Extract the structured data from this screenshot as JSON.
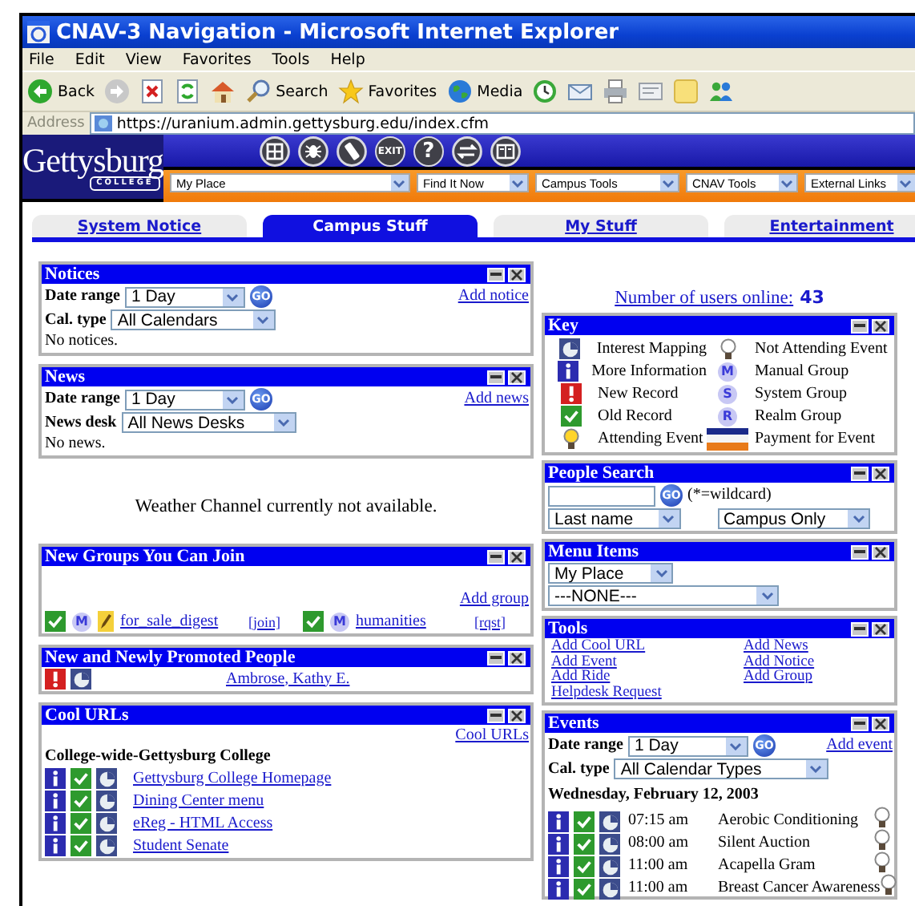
{
  "window": {
    "title": "CNAV-3 Navigation - Microsoft Internet Explorer"
  },
  "menu_bar": [
    "File",
    "Edit",
    "View",
    "Favorites",
    "Tools",
    "Help"
  ],
  "toolbar": [
    {
      "kind": "back",
      "label": "Back"
    },
    {
      "kind": "forward"
    },
    {
      "kind": "stop"
    },
    {
      "kind": "refresh"
    },
    {
      "kind": "home"
    },
    {
      "kind": "search",
      "label": "Search"
    },
    {
      "kind": "favorites",
      "label": "Favorites"
    },
    {
      "kind": "media",
      "label": "Media"
    },
    {
      "kind": "history"
    },
    {
      "kind": "mail"
    },
    {
      "kind": "print"
    },
    {
      "kind": "edit"
    },
    {
      "kind": "notes"
    },
    {
      "kind": "messenger"
    }
  ],
  "address_bar": {
    "label": "Address",
    "value": "https://uranium.admin.gettysburg.edu/index.cfm"
  },
  "site_header": {
    "logo": {
      "name": "Gettysburg",
      "subtitle": "COLLEGE"
    },
    "icons": [
      {
        "kind": "window"
      },
      {
        "kind": "bug"
      },
      {
        "kind": "phone"
      },
      {
        "kind": "label",
        "text": "EXIT"
      },
      {
        "kind": "label",
        "text": "?"
      },
      {
        "kind": "arrows"
      },
      {
        "kind": "book"
      }
    ],
    "dropdowns": [
      "My Place",
      "Find It Now",
      "Campus Tools",
      "CNAV Tools",
      "External Links"
    ]
  },
  "tabs": [
    {
      "label": "System Notice",
      "selected": false
    },
    {
      "label": "Campus Stuff",
      "selected": true
    },
    {
      "label": "My Stuff",
      "selected": false
    },
    {
      "label": "Entertainment",
      "selected": false
    }
  ],
  "left": [
    {
      "kind": "filter",
      "title": "Notices",
      "action": "Add notice",
      "filters": [
        {
          "label": "Date range",
          "value": "1 Day",
          "go": "GO"
        },
        {
          "label": "Cal. type",
          "value": "All Calendars"
        }
      ],
      "message": "No notices."
    },
    {
      "kind": "filter",
      "title": "News",
      "action": "Add news",
      "filters": [
        {
          "label": "Date range",
          "value": "1 Day",
          "go": "GO"
        },
        {
          "label": "News desk",
          "value": "All News Desks"
        }
      ],
      "message": "No news."
    },
    {
      "kind": "notice",
      "text": "Weather Channel currently not available."
    },
    {
      "kind": "groups",
      "title": "New Groups You Can Join",
      "action": "Add group",
      "groups": [
        {
          "kind": "old",
          "badge": "M",
          "editable": true,
          "name": "for_sale_digest",
          "action": "[join]"
        },
        {
          "kind": "old",
          "badge": "M",
          "editable": false,
          "name": "humanities",
          "action": "[rqst]"
        }
      ]
    },
    {
      "kind": "people",
      "title": "New and Newly Promoted People",
      "people": [
        {
          "kind": "new",
          "name": "Ambrose, Kathy E."
        }
      ]
    },
    {
      "kind": "links",
      "title": "Cool URLs",
      "action": "Cool URLs",
      "heading": "College-wide-Gettysburg College",
      "links": [
        {
          "kind": "old",
          "label": "Gettysburg College Homepage"
        },
        {
          "kind": "old",
          "label": "Dining Center menu"
        },
        {
          "kind": "old",
          "label": "eReg - HTML Access"
        },
        {
          "kind": "old",
          "label": "Student Senate"
        }
      ]
    }
  ],
  "right": [
    {
      "kind": "counter",
      "label": "Number of users online:",
      "value": "43"
    },
    {
      "kind": "key",
      "title": "Key",
      "items": [
        {
          "kind": "map",
          "label": "Interest Mapping"
        },
        {
          "kind": "bulb_off",
          "label": "Not Attending Event"
        },
        {
          "kind": "info",
          "label": "More Information"
        },
        {
          "kind": "badge",
          "badge": "M",
          "label": "Manual Group"
        },
        {
          "kind": "new",
          "label": "New Record"
        },
        {
          "kind": "badge",
          "badge": "S",
          "label": "System Group"
        },
        {
          "kind": "old",
          "label": "Old Record"
        },
        {
          "kind": "badge",
          "badge": "R",
          "label": "Realm Group"
        },
        {
          "kind": "bulb_on",
          "label": "Attending Event"
        },
        {
          "kind": "card",
          "label": "Payment for Event"
        }
      ]
    },
    {
      "kind": "search",
      "title": "People Search",
      "go": "GO",
      "hint": "(*=wildcard)",
      "selects": [
        "Last name",
        "Campus Only"
      ]
    },
    {
      "kind": "menu",
      "title": "Menu Items",
      "selects": [
        "My Place",
        "---NONE---"
      ]
    },
    {
      "kind": "tools",
      "title": "Tools",
      "links": [
        "Add Cool URL",
        "Add News",
        "Add Event",
        "Add Notice",
        "Add Ride",
        "Add Group",
        "Helpdesk Request"
      ]
    },
    {
      "kind": "filter",
      "title": "Events",
      "action": "Add event",
      "filters": [
        {
          "label": "Date range",
          "value": "1 Day",
          "go": "GO"
        },
        {
          "label": "Cal. type",
          "value": "All Calendar Types"
        }
      ],
      "date_heading": "Wednesday, February 12, 2003",
      "events": [
        {
          "kind": "old",
          "time": "07:15 am",
          "title": "Aerobic Conditioning",
          "attending": false
        },
        {
          "kind": "old",
          "time": "08:00 am",
          "title": "Silent Auction",
          "attending": false
        },
        {
          "kind": "old",
          "time": "11:00 am",
          "title": "Acapella Gram",
          "attending": false
        },
        {
          "kind": "old",
          "time": "11:00 am",
          "title": "Breast Cancer Awareness",
          "attending": false
        }
      ]
    }
  ]
}
